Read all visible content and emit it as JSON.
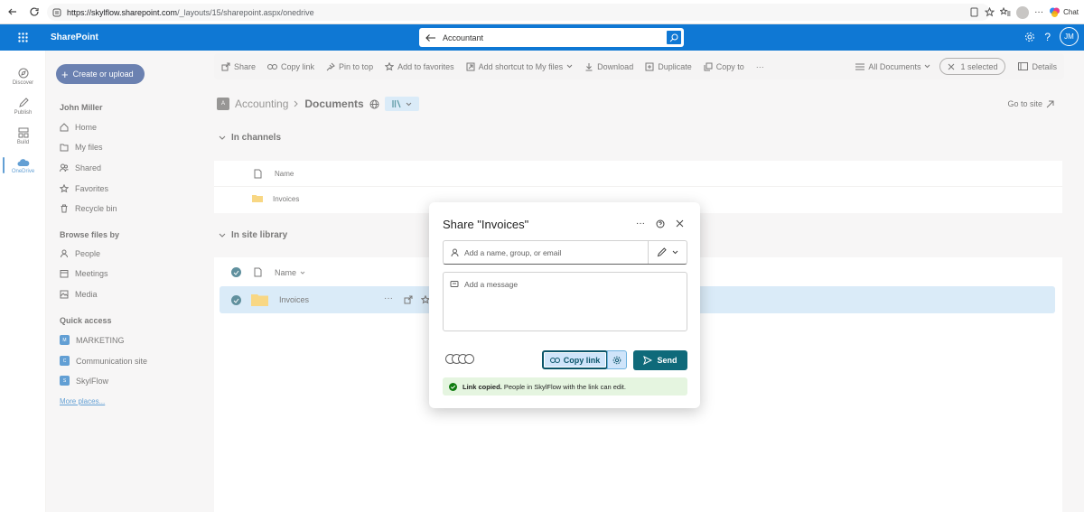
{
  "browser": {
    "url_host": "https://skylflow.sharepoint.com",
    "url_path": "/_layouts/15/sharepoint.aspx/onedrive",
    "chat_label": "Chat"
  },
  "topbar": {
    "brand": "SharePoint",
    "search_value": "Accountant",
    "help": "?",
    "user_initials": "JM"
  },
  "rail": {
    "items": [
      {
        "label": "Discover"
      },
      {
        "label": "Publish"
      },
      {
        "label": "Build"
      },
      {
        "label": "OneDrive"
      }
    ]
  },
  "leftnav": {
    "create_label": "Create or upload",
    "user_name": "John Miller",
    "links": [
      {
        "label": "Home"
      },
      {
        "label": "My files"
      },
      {
        "label": "Shared"
      },
      {
        "label": "Favorites"
      },
      {
        "label": "Recycle bin"
      }
    ],
    "browse_heading": "Browse files by",
    "browse_links": [
      {
        "label": "People"
      },
      {
        "label": "Meetings"
      },
      {
        "label": "Media"
      }
    ],
    "quick_access_heading": "Quick access",
    "quick_links": [
      {
        "label": "MARKETING",
        "badge": "M"
      },
      {
        "label": "Communication site",
        "badge": "C"
      },
      {
        "label": "SkylFlow",
        "badge": "S"
      }
    ],
    "more_places": "More places..."
  },
  "commands": {
    "share": "Share",
    "copy_link": "Copy link",
    "pin_to_top": "Pin to top",
    "add_favorites": "Add to favorites",
    "add_shortcut": "Add shortcut to My files",
    "download": "Download",
    "duplicate": "Duplicate",
    "copy_to": "Copy to",
    "more": "···",
    "all_documents": "All Documents",
    "selected": "1 selected",
    "details": "Details"
  },
  "breadcrumb": {
    "site_badge": "A",
    "site": "Accounting",
    "library": "Documents",
    "goto_site": "Go to site"
  },
  "channels": {
    "heading": "In channels",
    "col_name": "Name",
    "folder": "Invoices"
  },
  "library": {
    "heading": "In site library",
    "col_name": "Name",
    "folder": "Invoices"
  },
  "dialog": {
    "title": "Share \"Invoices\"",
    "more": "···",
    "people_placeholder": "Add a name, group, or email",
    "message_placeholder": "Add a message",
    "copy_link": "Copy link",
    "send": "Send",
    "toast_bold": "Link copied.",
    "toast_text": " People in SkylFlow with the link can edit."
  }
}
